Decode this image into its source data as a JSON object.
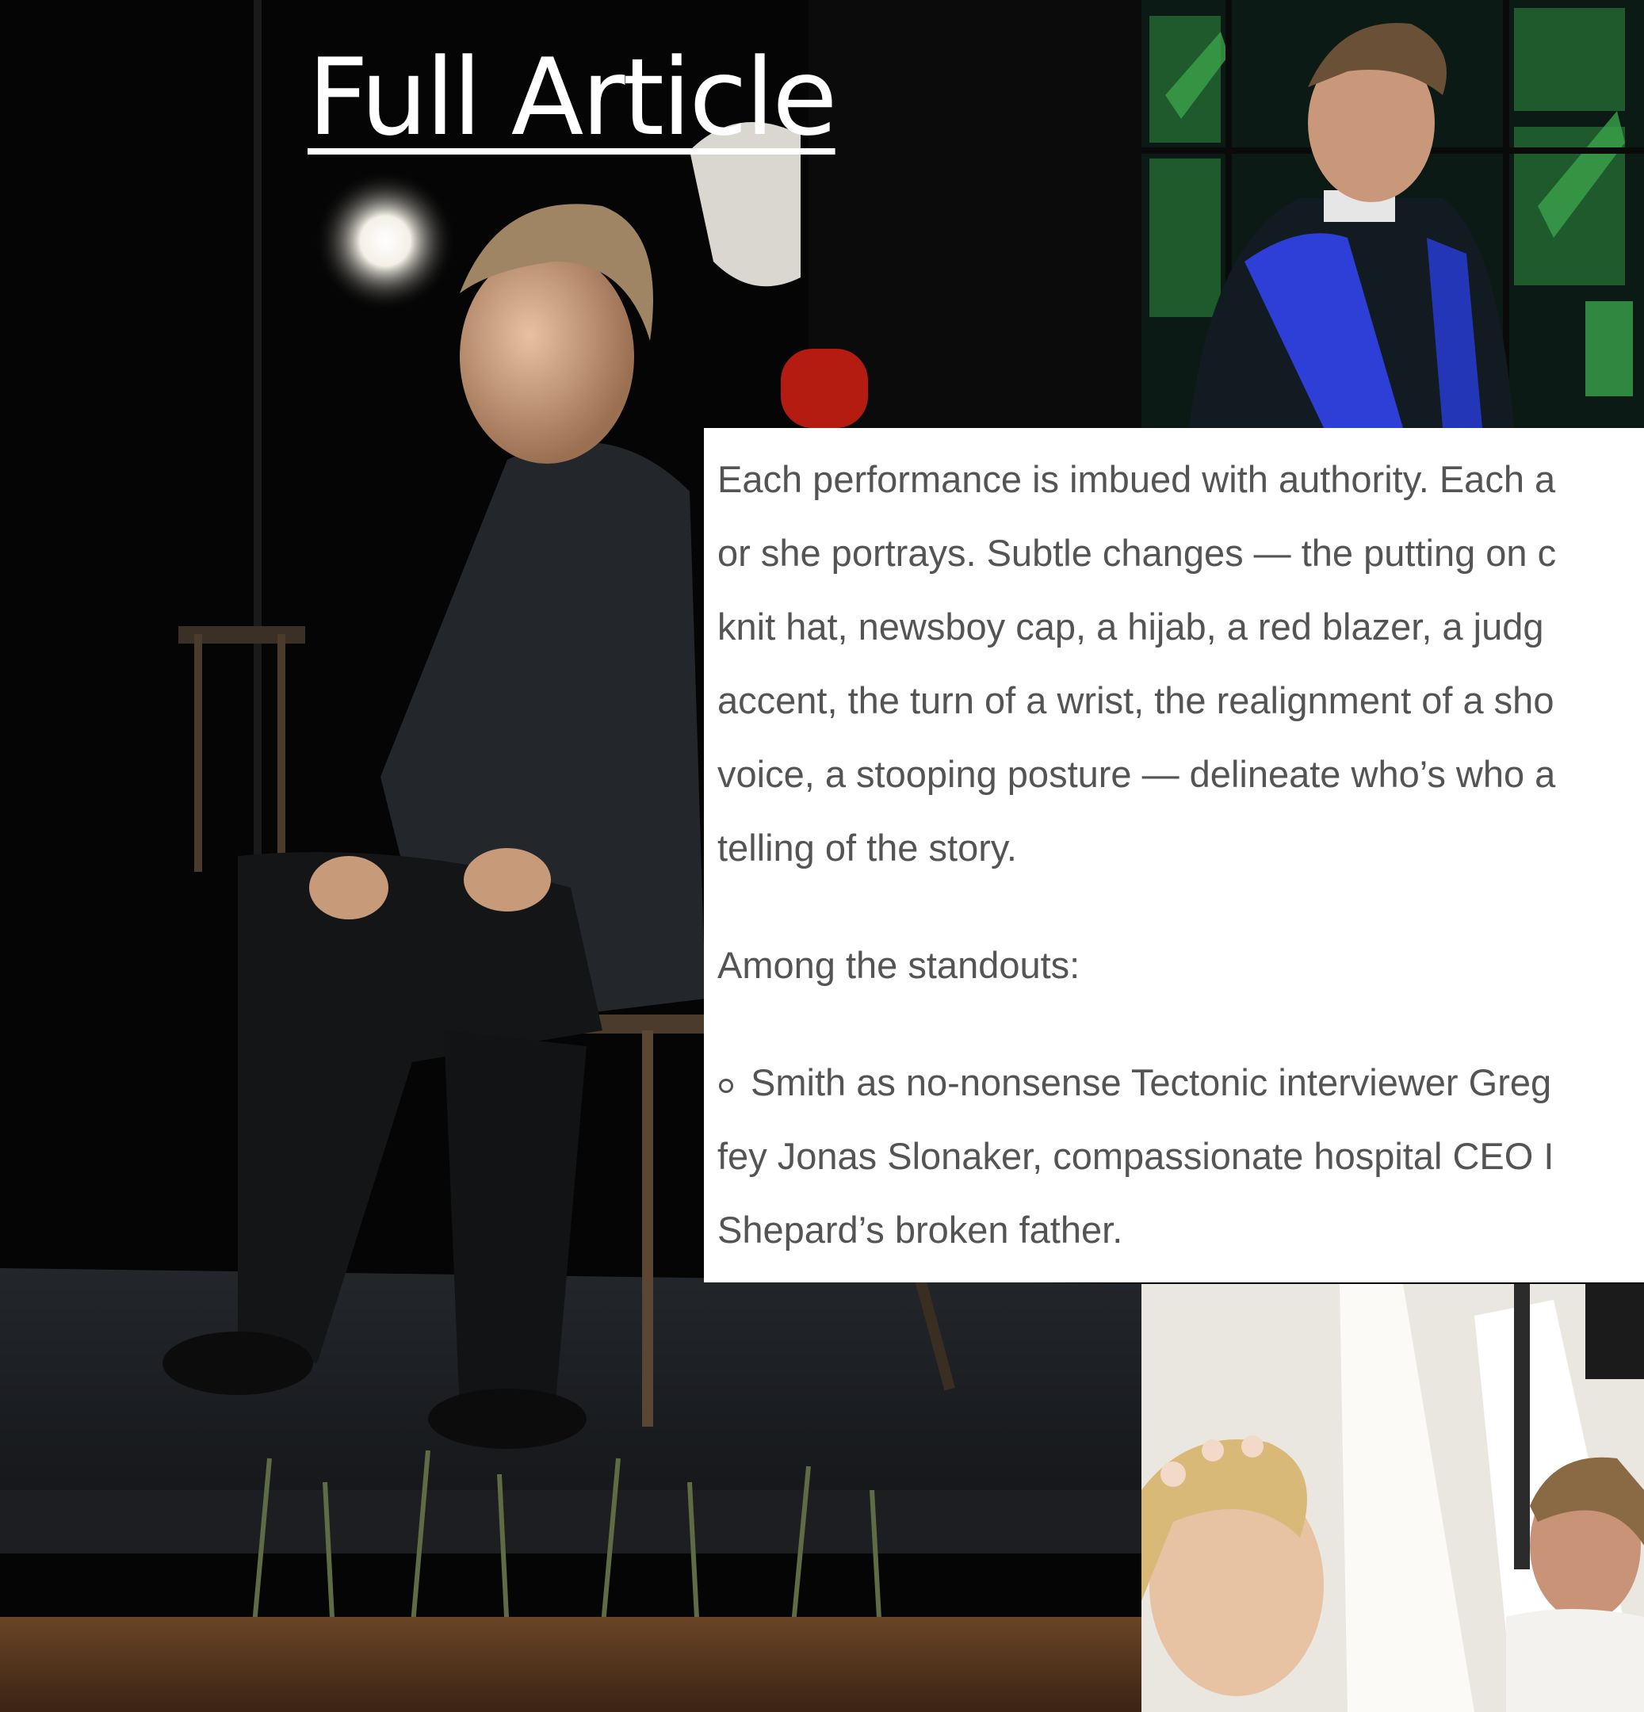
{
  "header": {
    "full_article_link": "Full Article"
  },
  "photos": {
    "main": "actor-seated-on-stage",
    "top_right": "actor-in-clerical-robe-stained-glass",
    "bottom_right": "actors-in-white-with-flower-crowns"
  },
  "article": {
    "paragraph_lines": [
      "Each performance is imbued with authority. Each a",
      "or she portrays. Subtle changes — the putting on c",
      "knit hat, newsboy cap, a hijab, a red blazer, a judg",
      "accent, the turn of a wrist, the realignment of a sho",
      "voice, a stooping posture — delineate who’s who a",
      "telling of the story."
    ],
    "standouts_label": "Among the standouts:",
    "bullet_lines": [
      "Smith as no-nonsense Tectonic interviewer Greg",
      "fey Jonas Slonaker, compassionate hospital CEO I",
      "Shepard’s broken father."
    ]
  },
  "colors": {
    "page_background": "#000000",
    "card_background": "#ffffff",
    "article_text": "#545454",
    "link_text": "#ffffff",
    "stole_blue": "#2d3fd6",
    "stained_glass_green": "#2f8a3a"
  }
}
